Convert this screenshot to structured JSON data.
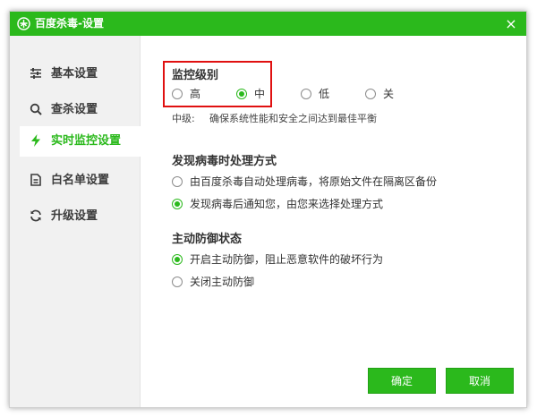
{
  "window": {
    "title": "百度杀毒-设置",
    "close_symbol": "×"
  },
  "sidebar": {
    "items": [
      {
        "label": "基本设置",
        "icon": "sliders-icon",
        "active": false
      },
      {
        "label": "查杀设置",
        "icon": "search-icon",
        "active": false
      },
      {
        "label": "实时监控设置",
        "icon": "lightning-icon",
        "active": true
      },
      {
        "label": "白名单设置",
        "icon": "document-icon",
        "active": false
      },
      {
        "label": "升级设置",
        "icon": "refresh-icon",
        "active": false
      }
    ]
  },
  "monitor_level": {
    "title": "监控级别",
    "options": [
      "高",
      "中",
      "低",
      "关"
    ],
    "selected": "中",
    "description_label": "中级:",
    "description_text": "确保系统性能和安全之间达到最佳平衡"
  },
  "virus_action": {
    "title": "发现病毒时处理方式",
    "options": [
      "由百度杀毒自动处理病毒，将原始文件在隔离区备份",
      "发现病毒后通知您，由您来选择处理方式"
    ],
    "selected_index": 1
  },
  "active_defense": {
    "title": "主动防御状态",
    "options": [
      "开启主动防御，阻止恶意软件的破坏行为",
      "关闭主动防御"
    ],
    "selected_index": 0
  },
  "buttons": {
    "ok": "确定",
    "cancel": "取消"
  },
  "colors": {
    "accent": "#2bb91c",
    "highlight": "#e01010"
  }
}
